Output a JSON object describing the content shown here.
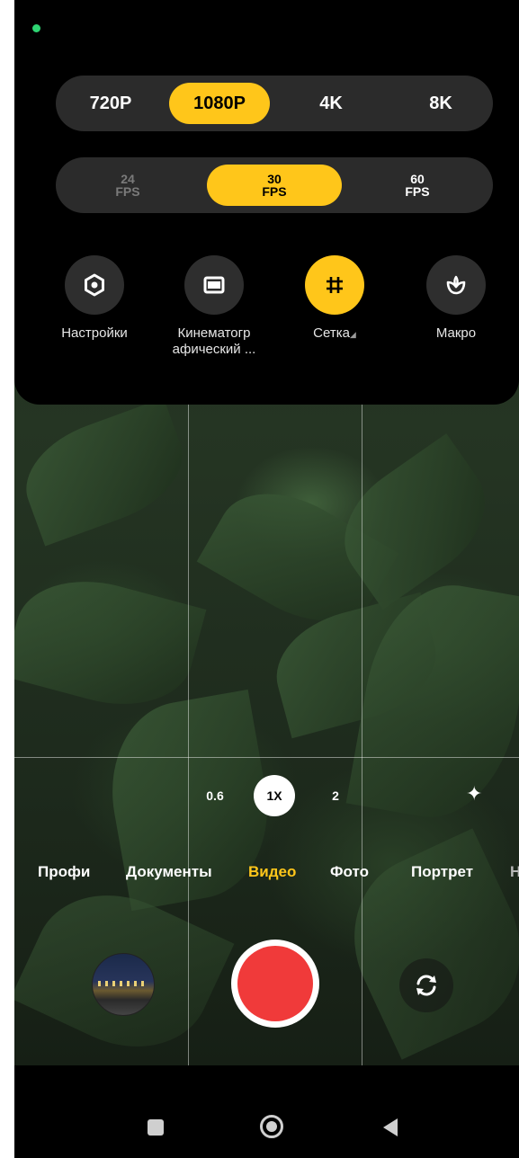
{
  "resolution": {
    "options": [
      "720P",
      "1080P",
      "4K",
      "8K"
    ],
    "selected": "1080P"
  },
  "fps": {
    "options": [
      {
        "num": "24",
        "unit": "FPS"
      },
      {
        "num": "30",
        "unit": "FPS"
      },
      {
        "num": "60",
        "unit": "FPS"
      }
    ],
    "selected": "30"
  },
  "tools": [
    {
      "label": "Настройки",
      "icon": "settings-icon"
    },
    {
      "label": "Кинематографический ...",
      "label_line1": "Кинематогр",
      "label_line2": "афический ...",
      "icon": "cinematic-icon"
    },
    {
      "label": "Сетка",
      "icon": "grid-icon",
      "active": true
    },
    {
      "label": "Макро",
      "icon": "macro-icon"
    }
  ],
  "zoom": {
    "options": [
      "0.6",
      "1X",
      "2"
    ],
    "selected": "1X"
  },
  "modes": {
    "items": [
      "Профи",
      "Документы",
      "Видео",
      "Фото",
      "Портрет",
      "Но"
    ],
    "selected": "Видео"
  },
  "colors": {
    "accent": "#ffc61a",
    "record": "#f03a3a",
    "panel": "#2b2b2b"
  }
}
